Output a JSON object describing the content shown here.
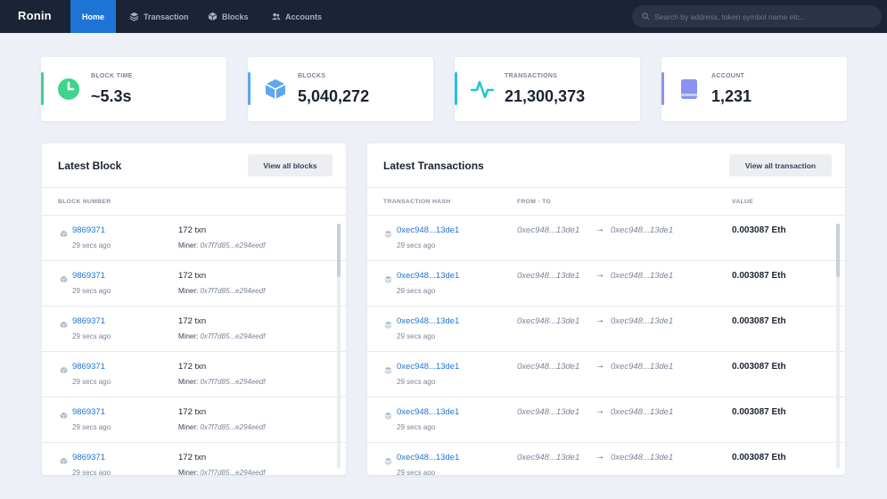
{
  "nav": {
    "logo": "Ronin",
    "items": [
      {
        "label": "Home",
        "icon": "home"
      },
      {
        "label": "Transaction",
        "icon": "layers-icon"
      },
      {
        "label": "Blocks",
        "icon": "cube-icon"
      },
      {
        "label": "Accounts",
        "icon": "users-icon"
      }
    ],
    "search_placeholder": "Search by address, token symbol name etc..."
  },
  "stats": [
    {
      "label": "BLOCK TIME",
      "value": "~5.3s",
      "icon": "clock-icon",
      "color": "#3fd48c"
    },
    {
      "label": "BLOCKS",
      "value": "5,040,272",
      "icon": "cube-icon",
      "color": "#5ba8f0"
    },
    {
      "label": "TRANSACTIONS",
      "value": "21,300,373",
      "icon": "activity-icon",
      "color": "#1fc4d8"
    },
    {
      "label": "ACCOUNT",
      "value": "1,231",
      "icon": "book-icon",
      "color": "#8a92f0"
    }
  ],
  "latest_block": {
    "title": "Latest Block",
    "button": "View all blocks",
    "col_header": "BLOCK NUMBER",
    "rows": [
      {
        "number": "9869371",
        "time": "29 secs ago",
        "txn": "172 txn",
        "miner_label": "Miner:",
        "miner": "0x7f7d85...e294eedf"
      },
      {
        "number": "9869371",
        "time": "29 secs ago",
        "txn": "172 txn",
        "miner_label": "Miner:",
        "miner": "0x7f7d85...e294eedf"
      },
      {
        "number": "9869371",
        "time": "29 secs ago",
        "txn": "172 txn",
        "miner_label": "Miner:",
        "miner": "0x7f7d85...e294eedf"
      },
      {
        "number": "9869371",
        "time": "29 secs ago",
        "txn": "172 txn",
        "miner_label": "Miner:",
        "miner": "0x7f7d85...e294eedf"
      },
      {
        "number": "9869371",
        "time": "29 secs ago",
        "txn": "172 txn",
        "miner_label": "Miner:",
        "miner": "0x7f7d85...e294eedf"
      },
      {
        "number": "9869371",
        "time": "29 secs ago",
        "txn": "172 txn",
        "miner_label": "Miner:",
        "miner": "0x7f7d85...e294eedf"
      }
    ]
  },
  "latest_transactions": {
    "title": "Latest Transactions",
    "button": "View all transaction",
    "col_hash": "TRANSACTION HASH",
    "col_fromto": "FROM - TO",
    "col_value": "VALUE",
    "rows": [
      {
        "hash": "0xec948...13de1",
        "time": "29 secs ago",
        "from": "0xec948...13de1",
        "arrow": "→",
        "to": "0xec948...13de1",
        "value": "0.003087 Eth"
      },
      {
        "hash": "0xec948...13de1",
        "time": "29 secs ago",
        "from": "0xec948...13de1",
        "arrow": "→",
        "to": "0xec948...13de1",
        "value": "0.003087 Eth"
      },
      {
        "hash": "0xec948...13de1",
        "time": "29 secs ago",
        "from": "0xec948...13de1",
        "arrow": "→",
        "to": "0xec948...13de1",
        "value": "0.003087 Eth"
      },
      {
        "hash": "0xec948...13de1",
        "time": "29 secs ago",
        "from": "0xec948...13de1",
        "arrow": "→",
        "to": "0xec948...13de1",
        "value": "0.003087 Eth"
      },
      {
        "hash": "0xec948...13de1",
        "time": "29 secs ago",
        "from": "0xec948...13de1",
        "arrow": "→",
        "to": "0xec948...13de1",
        "value": "0.003087 Eth"
      },
      {
        "hash": "0xec948...13de1",
        "time": "29 secs ago",
        "from": "0xec948...13de1",
        "arrow": "→",
        "to": "0xec948...13de1",
        "value": "0.003087 Eth"
      }
    ]
  }
}
